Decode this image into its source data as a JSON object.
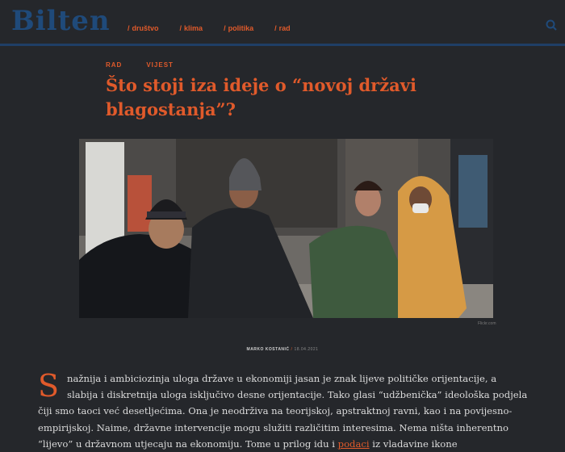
{
  "site": {
    "logo": "Bilten"
  },
  "nav": [
    {
      "label": "društvo"
    },
    {
      "label": "klima"
    },
    {
      "label": "politika"
    },
    {
      "label": "rad"
    }
  ],
  "article": {
    "category": "RAD",
    "type": "VIJEST",
    "title": "Što stoji iza ideje o “novoj državi blagostanja”?",
    "photo_credit": "Flickr.com",
    "author": "MARKO KOSTANIĆ",
    "date": "18.04.2021",
    "dropcap": "S",
    "paragraph_start": "nažnija i ambiciozinja uloga države u ekonomiji jasan je znak lijeve političke orijentacije, a slabija i diskretnija uloga isključivo desne orijentacije. Tako glasi “udžbenička” ideološka podjela čiji smo taoci već desetljećima. Ona je neodrživa na teorijskoj, apstraktnoj ravni, kao i na povijesno-empirijskoj. Naime, državne intervencije mogu služiti različitim interesima. Nema ništa inherentno “lijevo” u državnom utjecaju na ekonomiju. Tome u prilog idu i ",
    "link_text": "podaci",
    "paragraph_end": " iz vladavine ikone"
  },
  "colors": {
    "accent": "#e05a2b",
    "brand": "#1f4a7a",
    "background": "#25272b"
  }
}
